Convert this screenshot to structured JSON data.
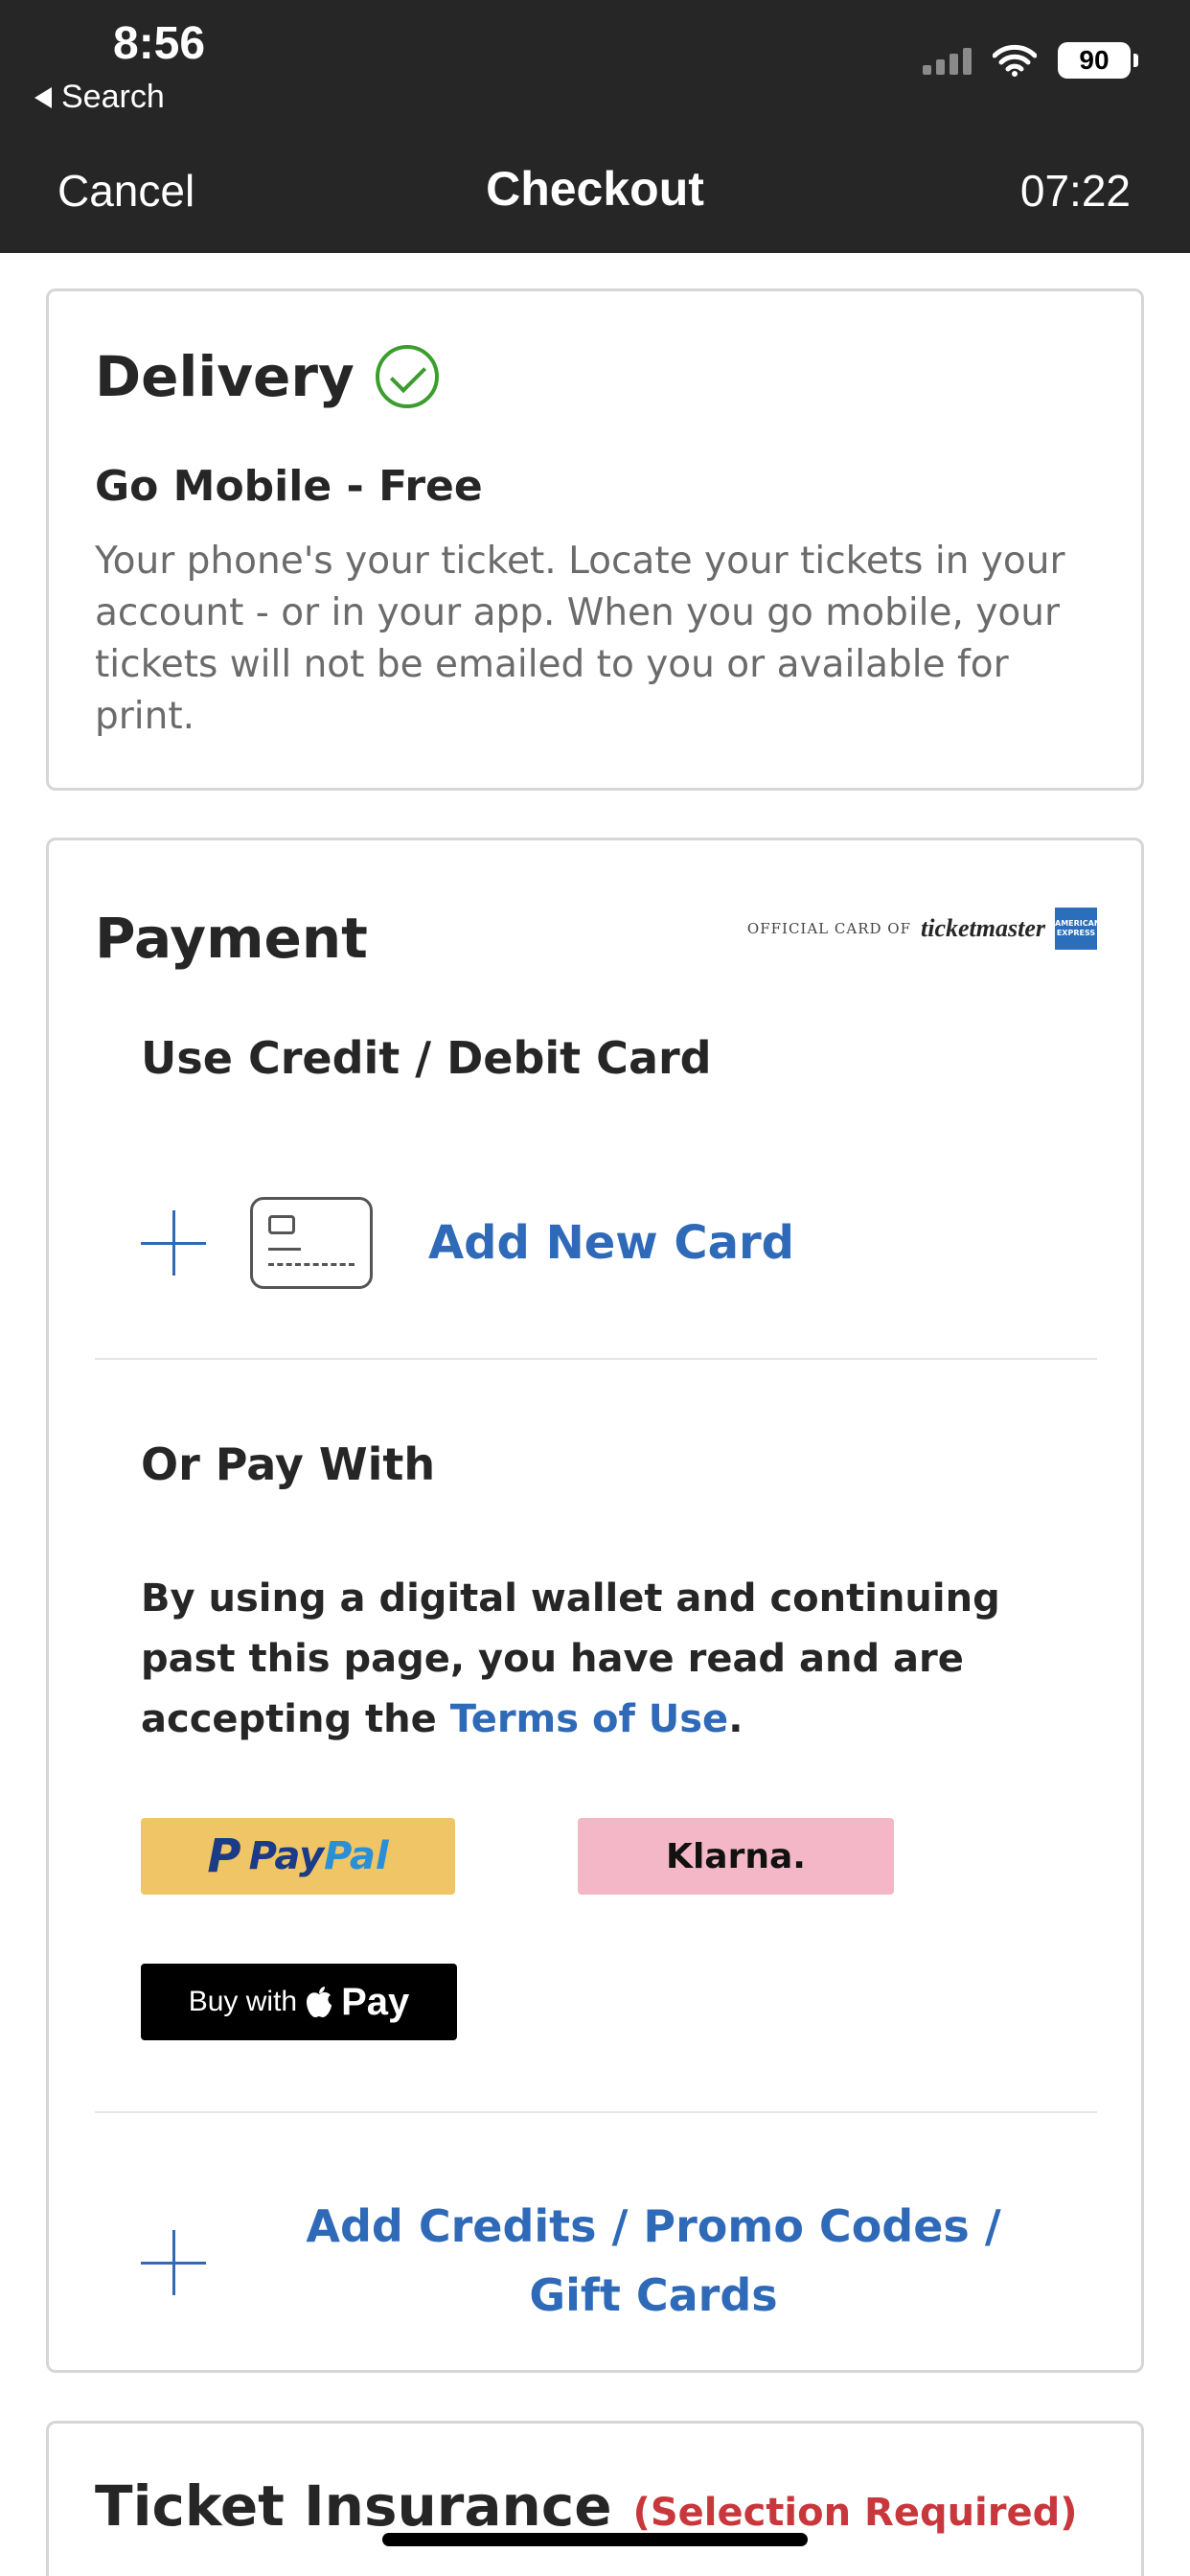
{
  "status_bar": {
    "time": "8:56",
    "back_label": "Search",
    "battery": "90"
  },
  "nav": {
    "cancel": "Cancel",
    "title": "Checkout",
    "timer": "07:22"
  },
  "delivery": {
    "title": "Delivery",
    "option": "Go Mobile - Free",
    "description": "Your phone's your ticket. Locate your tickets in your account - or in your app. When you go mobile, your tickets will not be emailed to you or available for print."
  },
  "payment": {
    "title": "Payment",
    "sponsor_prefix": "OFFICIAL CARD OF",
    "sponsor_brand": "ticketmaster",
    "amex_label": "AMERICAN EXPRESS",
    "use_card_heading": "Use Credit / Debit Card",
    "add_new_card": "Add New Card",
    "or_pay_with": "Or Pay With",
    "wallet_note": "By using a digital wallet and continuing past this page, you have read and are accepting the",
    "terms_link": "Terms of Use",
    "period": ".",
    "paypal_pay": "Pay",
    "paypal_pal": "Pal",
    "klarna": "Klarna.",
    "applepay_prefix": "Buy with",
    "applepay_brand": "Pay",
    "promo": "Add Credits / Promo Codes / Gift Cards"
  },
  "insurance": {
    "title": "Ticket Insurance",
    "required": "(Selection Required)"
  },
  "colors": {
    "header_bg": "#262626",
    "link_blue": "#2f6ab8",
    "success_green": "#3c9d2e",
    "required_red": "#c8373b",
    "paypal_bg": "#f0c566",
    "klarna_bg": "#f4b7c8"
  },
  "icons": [
    "back-arrow-icon",
    "signal-icon",
    "wifi-icon",
    "battery-icon",
    "check-circle-icon",
    "plus-icon",
    "credit-card-icon",
    "paypal-logo-icon",
    "apple-logo-icon",
    "amex-logo-icon"
  ]
}
